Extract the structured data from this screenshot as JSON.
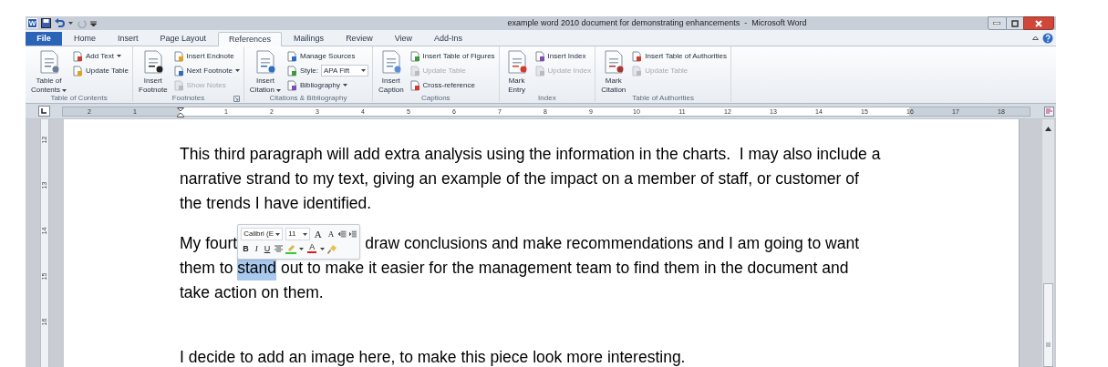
{
  "title_bar": {
    "app_icon": "W",
    "title": "example word 2010 document for demonstrating enhancements  -  Microsoft Word"
  },
  "tabs": [
    {
      "label": "File",
      "kind": "file",
      "selected": false
    },
    {
      "label": "Home",
      "kind": "tab",
      "selected": false
    },
    {
      "label": "Insert",
      "kind": "tab",
      "selected": false
    },
    {
      "label": "Page Layout",
      "kind": "tab",
      "selected": false
    },
    {
      "label": "References",
      "kind": "tab",
      "selected": true
    },
    {
      "label": "Mailings",
      "kind": "tab",
      "selected": false
    },
    {
      "label": "Review",
      "kind": "tab",
      "selected": false
    },
    {
      "label": "View",
      "kind": "tab",
      "selected": false
    },
    {
      "label": "Add-Ins",
      "kind": "tab",
      "selected": false
    }
  ],
  "ribbon_groups": [
    {
      "label": "Table of Contents",
      "dialog_launcher": false,
      "large": [
        {
          "lines": [
            "Table of",
            "Contents"
          ],
          "dropdown": true
        }
      ],
      "small": [
        {
          "kind": "item",
          "label": "Add Text",
          "dropdown": true,
          "disabled": false
        },
        {
          "kind": "item",
          "label": "Update Table",
          "dropdown": false,
          "disabled": false
        }
      ]
    },
    {
      "label": "Footnotes",
      "dialog_launcher": true,
      "large": [
        {
          "lines": [
            "Insert",
            "Footnote"
          ],
          "dropdown": false
        }
      ],
      "small": [
        {
          "kind": "item",
          "label": "Insert Endnote",
          "dropdown": false,
          "disabled": false
        },
        {
          "kind": "item",
          "label": "Next Footnote",
          "dropdown": true,
          "disabled": false
        },
        {
          "kind": "item",
          "label": "Show Notes",
          "dropdown": false,
          "disabled": true
        }
      ]
    },
    {
      "label": "Citations & Bibliography",
      "dialog_launcher": false,
      "large": [
        {
          "lines": [
            "Insert",
            "Citation"
          ],
          "dropdown": true
        }
      ],
      "small": [
        {
          "kind": "item",
          "label": "Manage Sources",
          "dropdown": false,
          "disabled": false
        },
        {
          "kind": "select",
          "label": "Style:",
          "value": "APA Fift",
          "dropdown": true
        },
        {
          "kind": "item",
          "label": "Bibliography",
          "dropdown": true,
          "disabled": false
        }
      ]
    },
    {
      "label": "Captions",
      "dialog_launcher": false,
      "large": [
        {
          "lines": [
            "Insert",
            "Caption"
          ],
          "dropdown": false
        }
      ],
      "small": [
        {
          "kind": "item",
          "label": "Insert Table of Figures",
          "dropdown": false,
          "disabled": false
        },
        {
          "kind": "item",
          "label": "Update Table",
          "dropdown": false,
          "disabled": true
        },
        {
          "kind": "item",
          "label": "Cross-reference",
          "dropdown": false,
          "disabled": false
        }
      ]
    },
    {
      "label": "Index",
      "dialog_launcher": false,
      "large": [
        {
          "lines": [
            "Mark",
            "Entry"
          ],
          "dropdown": false
        }
      ],
      "small": [
        {
          "kind": "item",
          "label": "Insert Index",
          "dropdown": false,
          "disabled": false
        },
        {
          "kind": "item",
          "label": "Update Index",
          "dropdown": false,
          "disabled": true
        }
      ]
    },
    {
      "label": "Table of Authorities",
      "dialog_launcher": false,
      "large": [
        {
          "lines": [
            "Mark",
            "Citation"
          ],
          "dropdown": false
        }
      ],
      "small": [
        {
          "kind": "item",
          "label": "Insert Table of Authorities",
          "dropdown": false,
          "disabled": false
        },
        {
          "kind": "item",
          "label": "Update Table",
          "dropdown": false,
          "disabled": true
        }
      ]
    }
  ],
  "ruler": {
    "left_numbers": [
      "2",
      "1"
    ],
    "numbers": [
      "1",
      "2",
      "3",
      "4",
      "5",
      "6",
      "7",
      "8",
      "9",
      "10",
      "11",
      "12",
      "13",
      "14",
      "15",
      "16",
      "17",
      "18"
    ],
    "vertical_numbers": [
      "12",
      "13",
      "14",
      "15",
      "16"
    ]
  },
  "mini_toolbar": {
    "font": "Calibri (E",
    "size": "11",
    "grow": "A",
    "shrink": "A",
    "bold": "B",
    "italic": "I",
    "underline": "U",
    "font_color": "A"
  },
  "paragraphs": [
    {
      "space_before": false,
      "lines": [
        [
          {
            "kind": "text",
            "text": "This third paragraph will add extra analysis using the information in the charts.  I may also include a"
          }
        ],
        [
          {
            "kind": "text",
            "text": "narrative strand to my text, giving an example of the impact on a member of staff, or customer of"
          }
        ],
        [
          {
            "kind": "text",
            "text": "the trends I have identified."
          }
        ]
      ]
    },
    {
      "space_before": false,
      "lines": [
        [
          {
            "kind": "text",
            "text": "My fourt"
          },
          {
            "kind": "toolbar"
          },
          {
            "kind": "text",
            "text": "draw conclusions and make recommendations and I am going to want"
          }
        ],
        [
          {
            "kind": "text",
            "text": "them to "
          },
          {
            "kind": "selection",
            "text": "stand"
          },
          {
            "kind": "text",
            "text": " out to make it easier for the management team to find them in the document and"
          }
        ],
        [
          {
            "kind": "text",
            "text": "take action on them."
          }
        ]
      ]
    },
    {
      "space_before": true,
      "lines": [
        [
          {
            "kind": "text",
            "text": "I decide to add an image here, to make this piece look more interesting."
          }
        ]
      ]
    }
  ]
}
